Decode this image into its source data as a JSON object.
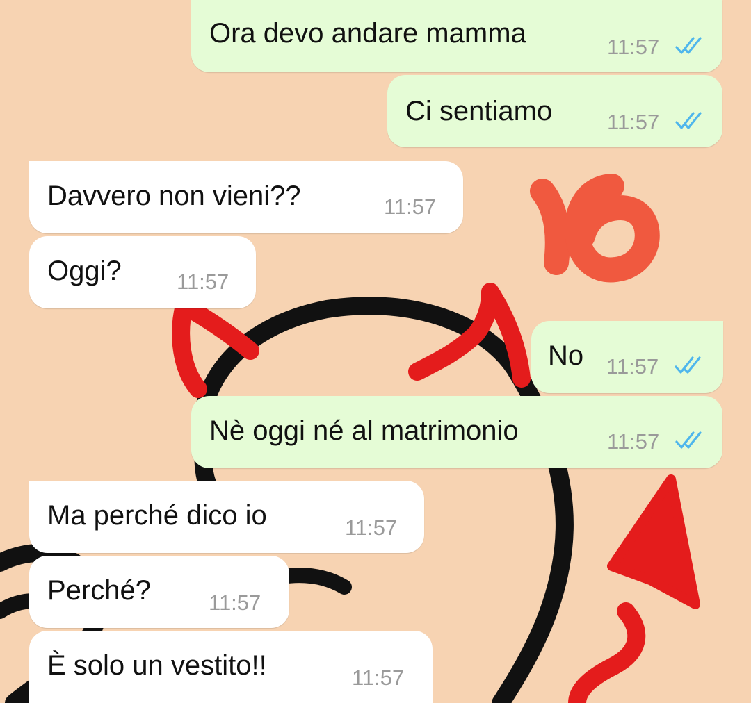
{
  "messages": [
    {
      "direction": "outgoing",
      "text": "Ora devo andare mamma",
      "time": "11:57",
      "status_icon": "double-check-read-icon"
    },
    {
      "direction": "outgoing",
      "text": "Ci sentiamo",
      "time": "11:57",
      "status_icon": "double-check-read-icon"
    },
    {
      "direction": "incoming",
      "text": "Davvero non vieni??",
      "time": "11:57"
    },
    {
      "direction": "incoming",
      "text": "Oggi?",
      "time": "11:57"
    },
    {
      "direction": "outgoing",
      "text": "No",
      "time": "11:57",
      "status_icon": "double-check-read-icon"
    },
    {
      "direction": "outgoing",
      "text": "Nè oggi né al matrimonio",
      "time": "11:57",
      "status_icon": "double-check-read-icon"
    },
    {
      "direction": "incoming",
      "text": "Ma perché dico io",
      "time": "11:57"
    },
    {
      "direction": "incoming",
      "text": "Perché?",
      "time": "11:57"
    },
    {
      "direction": "incoming",
      "text": "È solo un vestito!!",
      "time": "11:57"
    }
  ],
  "overlay": {
    "number_text": "16"
  },
  "colors": {
    "wallpaper": "#f7d3b2",
    "outgoing_bubble": "#e5fcd6",
    "incoming_bubble": "#ffffff",
    "read_ticks": "#4fb6ec",
    "overlay_number": "#f0593f",
    "devil_red": "#e41c1c"
  }
}
